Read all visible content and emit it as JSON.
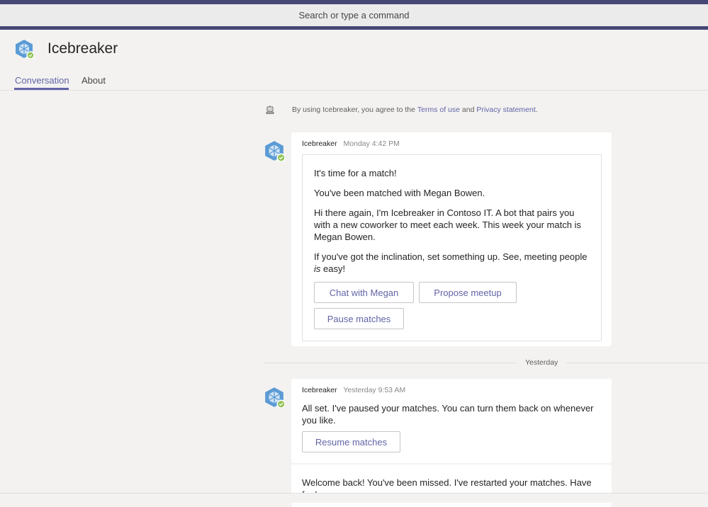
{
  "search": {
    "placeholder": "Search or type a command"
  },
  "app": {
    "title": "Icebreaker"
  },
  "tabs": [
    {
      "label": "Conversation",
      "active": true
    },
    {
      "label": "About",
      "active": false
    }
  ],
  "notice": {
    "prefix": "By using Icebreaker, you agree to the ",
    "terms_link": "Terms of use",
    "middle": " and ",
    "privacy_link": "Privacy statement",
    "suffix": "."
  },
  "messages": [
    {
      "sender": "Icebreaker",
      "time": "Monday 4:42 PM",
      "card": {
        "title": "It's time for a match!",
        "line1": "You've been matched with Megan Bowen.",
        "line2": "Hi there again, I'm Icebreaker in Contoso IT. A bot that pairs you with a new coworker to meet each week. This week your match is Megan Bowen.",
        "line3_before": "If you've got the inclination, set something up. See, meeting people ",
        "line3_em": "is",
        "line3_after": " easy!",
        "buttons": [
          "Chat with Megan",
          "Propose meetup",
          "Pause matches"
        ]
      }
    },
    {
      "sender": "Icebreaker",
      "time": "Yesterday 9:53 AM",
      "text": "All set. I've paused your matches. You can turn them back on whenever you like.",
      "button": "Resume matches"
    },
    {
      "text": "Welcome back! You've been missed. I've restarted your matches. Have fun!"
    }
  ],
  "divider": {
    "label": "Yesterday"
  },
  "colors": {
    "accent": "#6264a7",
    "header_bar": "#464775",
    "background": "#f3f2f1",
    "status": "#92c353"
  },
  "icons": [
    "icebreaker-logo-icon",
    "bot-icon",
    "available-status-icon"
  ]
}
